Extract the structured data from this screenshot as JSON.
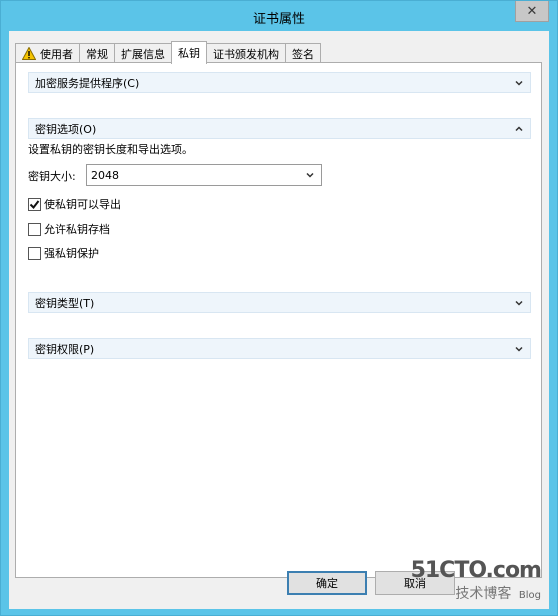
{
  "window": {
    "title": "证书属性",
    "close_glyph": "✕"
  },
  "tabs": [
    {
      "label": "使用者",
      "icon": "warning-icon",
      "active": false
    },
    {
      "label": "常规",
      "active": false
    },
    {
      "label": "扩展信息",
      "active": false
    },
    {
      "label": "私钥",
      "active": true
    },
    {
      "label": "证书颁发机构",
      "active": false
    },
    {
      "label": "签名",
      "active": false
    }
  ],
  "sections": {
    "csp": {
      "label": "加密服务提供程序(C)",
      "expanded": false
    },
    "key_options": {
      "label": "密钥选项(O)",
      "expanded": true
    },
    "key_type": {
      "label": "密钥类型(T)",
      "expanded": false
    },
    "key_permissions": {
      "label": "密钥权限(P)",
      "expanded": false
    }
  },
  "key_options": {
    "description": "设置私钥的密钥长度和导出选项。",
    "key_size_label": "密钥大小:",
    "key_size_value": "2048",
    "checkboxes": [
      {
        "label": "使私钥可以导出",
        "checked": true
      },
      {
        "label": "允许私钥存档",
        "checked": false
      },
      {
        "label": "强私钥保护",
        "checked": false
      }
    ]
  },
  "buttons": {
    "ok": "确定",
    "cancel": "取消"
  },
  "watermark": {
    "site": "51CTO.com",
    "tagline": "技术博客",
    "blog": "Blog"
  },
  "colors": {
    "titlebar": "#5bc4e8",
    "section_bg": "#eef5fb",
    "default_button_border": "#3c7fb1"
  }
}
